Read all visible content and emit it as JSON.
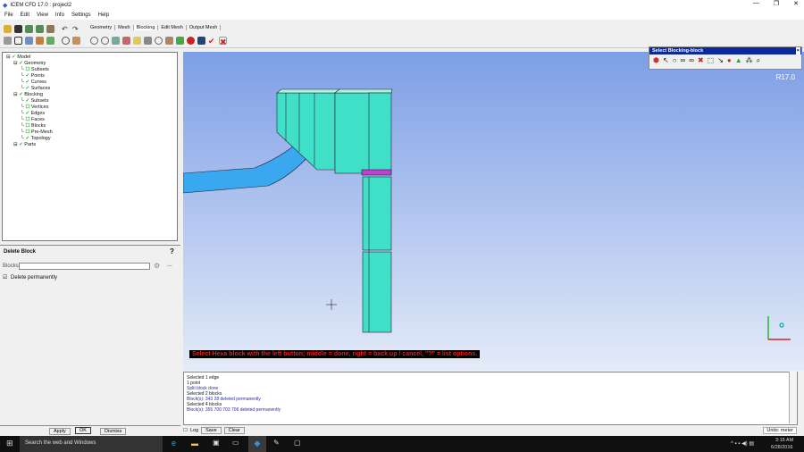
{
  "window": {
    "title": "ICEM CFD 17.0 : project2"
  },
  "menu": [
    "File",
    "Edit",
    "View",
    "Info",
    "Settings",
    "Help"
  ],
  "tabs": [
    "Geometry",
    "Mesh",
    "Blocking",
    "Edit Mesh",
    "Output Mesh"
  ],
  "active_tab": "Blocking",
  "tree": [
    {
      "label": "Model",
      "level": 0,
      "checked": true
    },
    {
      "label": "Geometry",
      "level": 1,
      "checked": true
    },
    {
      "label": "Subsets",
      "level": 2,
      "checked": false
    },
    {
      "label": "Points",
      "level": 2,
      "checked": true
    },
    {
      "label": "Curves",
      "level": 2,
      "checked": true
    },
    {
      "label": "Surfaces",
      "level": 2,
      "checked": true
    },
    {
      "label": "Blocking",
      "level": 1,
      "checked": true
    },
    {
      "label": "Subsets",
      "level": 2,
      "checked": true
    },
    {
      "label": "Vertices",
      "level": 2,
      "checked": false
    },
    {
      "label": "Edges",
      "level": 2,
      "checked": true
    },
    {
      "label": "Faces",
      "level": 2,
      "checked": false
    },
    {
      "label": "Blocks",
      "level": 2,
      "checked": false
    },
    {
      "label": "Pre-Mesh",
      "level": 2,
      "checked": false
    },
    {
      "label": "Topology",
      "level": 2,
      "checked": true
    },
    {
      "label": "Parts",
      "level": 1,
      "checked": true
    }
  ],
  "delete_panel": {
    "title": "Delete Block",
    "blocks_label": "Blocks",
    "blocks_value": "",
    "delete_permanently": "Delete permanently",
    "help": "?",
    "apply": "Apply",
    "ok": "OK",
    "dismiss": "Dismiss"
  },
  "select_toolbar": {
    "title": "Select Blocking-block",
    "close": "×"
  },
  "version": "R17.0",
  "prompt": "Select Hexa block with the left button; middle = done, right = back up / cancel, \"?\" = list options.",
  "messages": [
    {
      "text": "Selected 1 edge",
      "blue": false
    },
    {
      "text": "1 point",
      "blue": false
    },
    {
      "text": "Split block done",
      "blue": true
    },
    {
      "text": "Selected 2 blocks",
      "blue": false
    },
    {
      "text": "Block(s): 343 28 deleted permanently",
      "blue": true
    },
    {
      "text": "Selected 4 blocks",
      "blue": false
    },
    {
      "text": "Block(s): 355 700 703 706 deleted permanently",
      "blue": true
    }
  ],
  "msg_controls": {
    "log": "Log",
    "save": "Save",
    "clear": "Clear",
    "units": "Units: meter"
  },
  "taskbar": {
    "search": "Search the web and Windows",
    "time": "3:15 AM",
    "date": "6/28/2016"
  }
}
